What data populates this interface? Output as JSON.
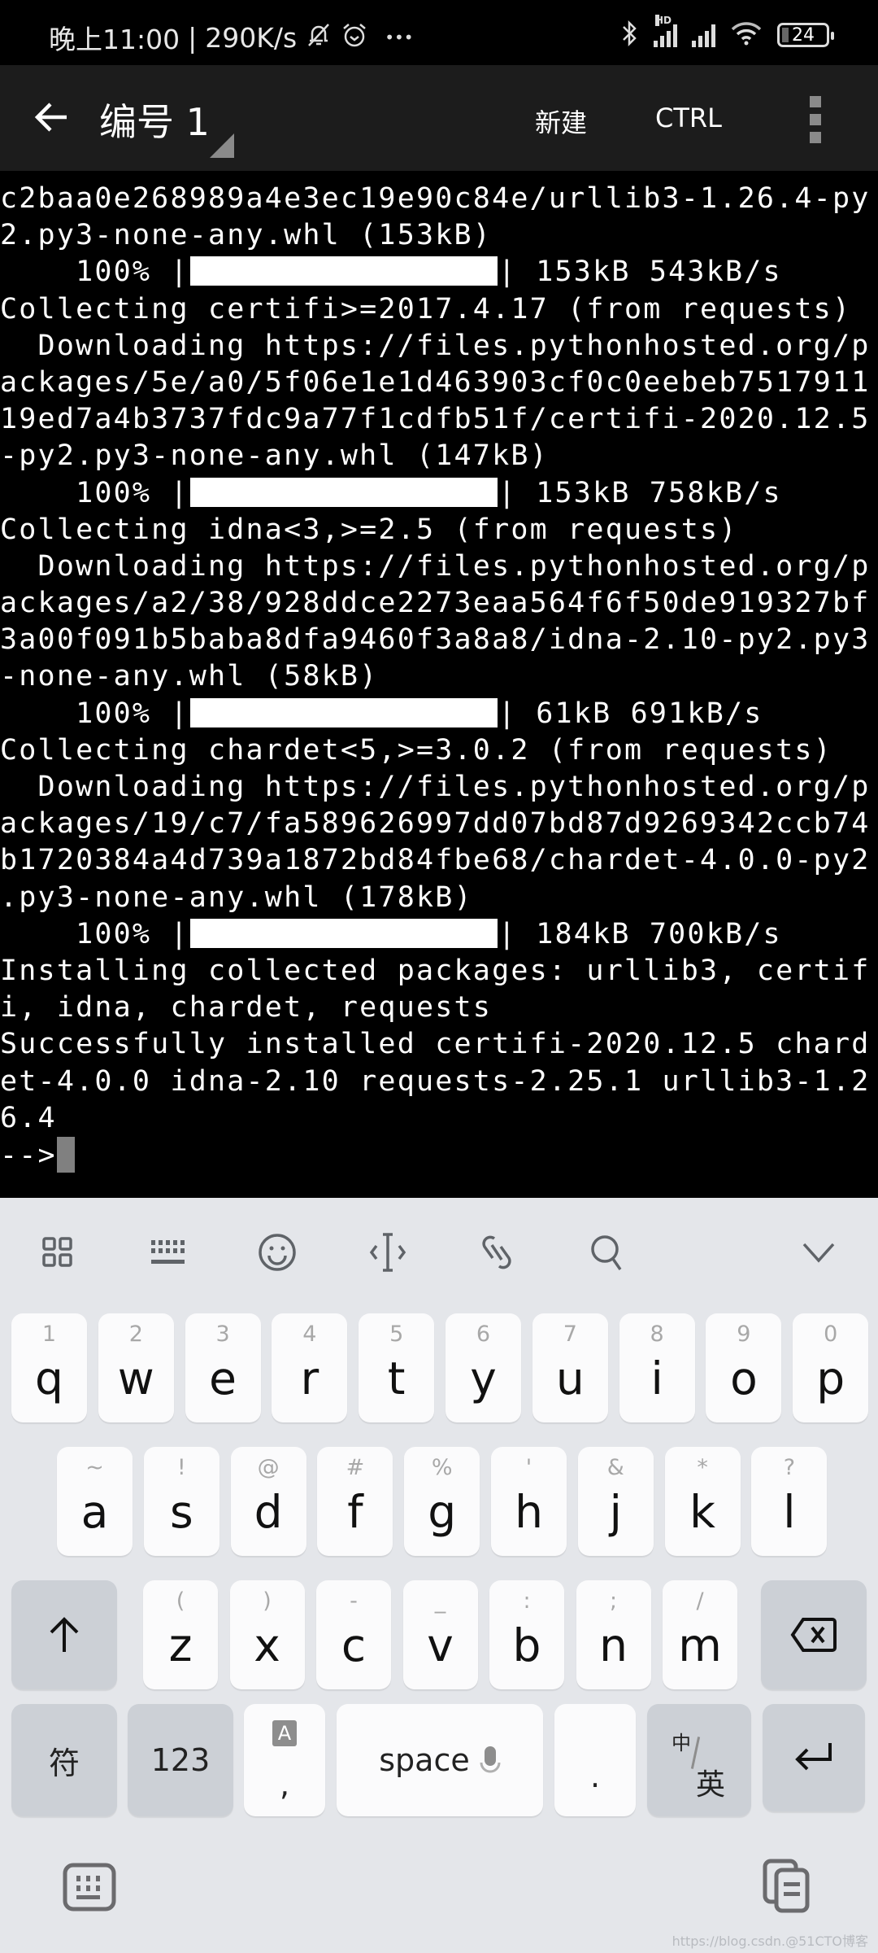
{
  "status_bar": {
    "time": "晚上11:00",
    "separator": "|",
    "net_speed": "290K/s",
    "icons": [
      "mute-bell-icon",
      "alarm-icon",
      "more-dots-icon",
      "bluetooth-icon",
      "signal-hd-icon",
      "signal-icon",
      "wifi-icon",
      "battery-icon"
    ],
    "hd_label": "HD",
    "more": "•••",
    "battery": "24"
  },
  "app_bar": {
    "title": "编号 1",
    "new_label": "新建",
    "ctrl_label": "CTRL"
  },
  "terminal": {
    "lines": [
      {
        "text": "c2baa0e268989a4e3ec19e90c84e/urllib3-1.26.4-py"
      },
      {
        "text": "2.py3-none-any.whl (153kB)"
      },
      {
        "progress": {
          "percent_label": "    100% |",
          "percent": 100,
          "suffix": "| 153kB 543kB/s"
        }
      },
      {
        "text": "Collecting certifi>=2017.4.17 (from requests)"
      },
      {
        "text": "  Downloading https://files.pythonhosted.org/p"
      },
      {
        "text": "ackages/5e/a0/5f06e1e1d463903cf0c0eebeb7517911"
      },
      {
        "text": "19ed7a4b3737fdc9a77f1cdfb51f/certifi-2020.12.5"
      },
      {
        "text": "-py2.py3-none-any.whl (147kB)"
      },
      {
        "progress": {
          "percent_label": "    100% |",
          "percent": 100,
          "suffix": "| 153kB 758kB/s"
        }
      },
      {
        "text": "Collecting idna<3,>=2.5 (from requests)"
      },
      {
        "text": "  Downloading https://files.pythonhosted.org/p"
      },
      {
        "text": "ackages/a2/38/928ddce2273eaa564f6f50de919327bf"
      },
      {
        "text": "3a00f091b5baba8dfa9460f3a8a8/idna-2.10-py2.py3"
      },
      {
        "text": "-none-any.whl (58kB)"
      },
      {
        "progress": {
          "percent_label": "    100% |",
          "percent": 100,
          "suffix": "| 61kB 691kB/s"
        }
      },
      {
        "text": "Collecting chardet<5,>=3.0.2 (from requests)"
      },
      {
        "text": "  Downloading https://files.pythonhosted.org/p"
      },
      {
        "text": "ackages/19/c7/fa589626997dd07bd87d9269342ccb74"
      },
      {
        "text": "b1720384a4d739a1872bd84fbe68/chardet-4.0.0-py2"
      },
      {
        "text": ".py3-none-any.whl (178kB)"
      },
      {
        "progress": {
          "percent_label": "    100% |",
          "percent": 100,
          "suffix": "| 184kB 700kB/s"
        }
      },
      {
        "text": "Installing collected packages: urllib3, certif"
      },
      {
        "text": "i, idna, chardet, requests"
      },
      {
        "text": "Successfully installed certifi-2020.12.5 chard"
      },
      {
        "text": "et-4.0.0 idna-2.10 requests-2.25.1 urllib3-1.2"
      },
      {
        "text": "6.4"
      }
    ],
    "prompt": "-->"
  },
  "keyboard": {
    "toolbar": [
      "apps-grid-icon",
      "keyboard-layout-icon",
      "emoji-icon",
      "cursor-move-icon",
      "clipboard-link-icon",
      "search-icon",
      "collapse-chevron-icon"
    ],
    "row1": [
      {
        "hint": "1",
        "key": "q"
      },
      {
        "hint": "2",
        "key": "w"
      },
      {
        "hint": "3",
        "key": "e"
      },
      {
        "hint": "4",
        "key": "r"
      },
      {
        "hint": "5",
        "key": "t"
      },
      {
        "hint": "6",
        "key": "y"
      },
      {
        "hint": "7",
        "key": "u"
      },
      {
        "hint": "8",
        "key": "i"
      },
      {
        "hint": "9",
        "key": "o"
      },
      {
        "hint": "0",
        "key": "p"
      }
    ],
    "row2": [
      {
        "hint": "~",
        "key": "a"
      },
      {
        "hint": "!",
        "key": "s"
      },
      {
        "hint": "@",
        "key": "d"
      },
      {
        "hint": "#",
        "key": "f"
      },
      {
        "hint": "%",
        "key": "g"
      },
      {
        "hint": "'",
        "key": "h"
      },
      {
        "hint": "&",
        "key": "j"
      },
      {
        "hint": "*",
        "key": "k"
      },
      {
        "hint": "?",
        "key": "l"
      }
    ],
    "row3": [
      {
        "hint": "(",
        "key": "z"
      },
      {
        "hint": ")",
        "key": "x"
      },
      {
        "hint": "-",
        "key": "c"
      },
      {
        "hint": "_",
        "key": "v"
      },
      {
        "hint": ":",
        "key": "b"
      },
      {
        "hint": ";",
        "key": "n"
      },
      {
        "hint": "/",
        "key": "m"
      }
    ],
    "symbols_label": "符",
    "numbers_label": "123",
    "comma_hint": "A",
    "comma": ",",
    "space_label": "space",
    "period": ".",
    "lang_top": "中",
    "lang_bottom": "英",
    "watermark": "https://blog.csdn.@51CTO博客"
  }
}
